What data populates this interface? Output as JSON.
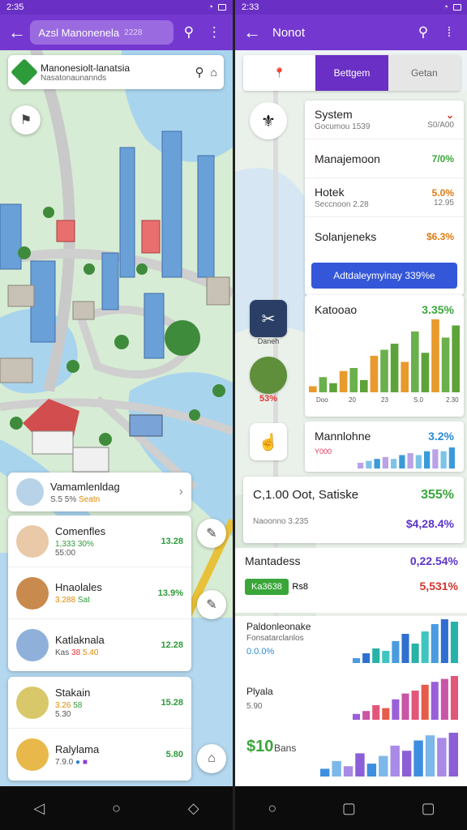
{
  "left": {
    "status_time": "2:35",
    "appbar": {
      "title": "Azsl Manonenela",
      "title_suffix": "2228"
    },
    "search_card": {
      "title": "Manonesiolt-lanatsia",
      "subtitle": "Nasatonaunannds"
    },
    "list_a": [
      {
        "name": "Vamamlenldag",
        "sub_1": "S.5 5%",
        "sub_2": "Seatn"
      }
    ],
    "list_b": [
      {
        "name": "Comenfles",
        "sub_1": "1,333",
        "sub_2": "30%",
        "sub_3": "55:00",
        "value": "13.28"
      },
      {
        "name": "Hnaolales",
        "sub_1": "3.288",
        "sub_2": "Sat",
        "value": "13.9%"
      },
      {
        "name": "Katlaknala",
        "sub_1": "Kas",
        "sub_2": "38",
        "sub_3": "5.40",
        "value": "12.28"
      }
    ],
    "list_c": [
      {
        "name": "Stakain",
        "sub_1": "3.26",
        "sub_2": "58",
        "sub_3": "5.30",
        "value": "15.28"
      },
      {
        "name": "Ralylama",
        "sub_1": "7.9.0",
        "value": "5.80"
      }
    ],
    "colors": {
      "appbar": "#7438d0",
      "green": "#2e9b3a"
    }
  },
  "right": {
    "status_time": "2:33",
    "appbar": {
      "title": "Nonot"
    },
    "tabs": {
      "first_icon": "pin-icon",
      "active": "Bettgem",
      "inactive": "Getan"
    },
    "summary": [
      {
        "label": "System",
        "sub": "Gocumou 1539",
        "value": "",
        "value_sub": "S0/A00"
      },
      {
        "label": "Manajemoon",
        "sub": "",
        "value": "7/0%",
        "value_sub": ""
      },
      {
        "label": "Hotek",
        "sub": "Seccnoon 2.28",
        "value": "5.0%",
        "value_sub": "12.95"
      },
      {
        "label": "Solanjeneks",
        "sub": "",
        "value": "$6.3%",
        "value_sub": ""
      }
    ],
    "primary_button": "Adtdaleymyinay 339%e",
    "side_items": [
      {
        "caption": "Daneh"
      },
      {
        "caption": "53%"
      },
      {
        "caption": ""
      }
    ],
    "chart1": {
      "title": "Katooao",
      "value": "3.35%",
      "ticks": [
        "Doo",
        "20",
        "23",
        "S.0",
        "2.30"
      ]
    },
    "chart2": {
      "title": "Mannlohne",
      "value": "3.2%",
      "sub": "Y000"
    },
    "total": {
      "label": "C,1.00 Oot, Satiske",
      "value": "355%",
      "sub": "Naoonno 3.235",
      "sub_value": "$4,28.4%"
    },
    "mantadess": {
      "label": "Mantadess",
      "value": "0,22.54%",
      "badge": "Ka3638",
      "badge_suffix": "Rs8",
      "value2": "5,531%"
    },
    "chart3": {
      "title": "Paldonleonake",
      "sub": "Fonsatarclanlos",
      "value": "0.0.0%"
    },
    "chart4": {
      "title": "Plyala",
      "value": "5.90"
    },
    "chart5": {
      "title": "$10",
      "sub": "Bans"
    },
    "colors": {
      "purple": "#5b35c8",
      "green": "#3aa63a",
      "orange": "#e07a12",
      "red": "#d4352f"
    }
  },
  "chart_data": [
    {
      "type": "bar",
      "title": "Katooao",
      "values": [
        2,
        5,
        3,
        7,
        8,
        4,
        12,
        14,
        16,
        10,
        20,
        13,
        24,
        18,
        22
      ]
    },
    {
      "type": "bar",
      "title": "Mannlohne",
      "values": [
        3,
        4,
        5,
        6,
        5,
        7,
        8,
        7,
        9,
        10,
        9,
        11
      ]
    },
    {
      "type": "bar",
      "title": "Paldonleonake",
      "values": [
        2,
        4,
        6,
        5,
        9,
        12,
        8,
        13,
        16,
        18,
        17
      ]
    },
    {
      "type": "bar",
      "title": "Plyala",
      "values": [
        2,
        3,
        5,
        4,
        7,
        9,
        10,
        12,
        13,
        14,
        15
      ]
    },
    {
      "type": "bar",
      "title": "$10",
      "values": [
        3,
        6,
        4,
        9,
        5,
        8,
        12,
        10,
        14,
        16,
        15,
        17
      ]
    }
  ]
}
